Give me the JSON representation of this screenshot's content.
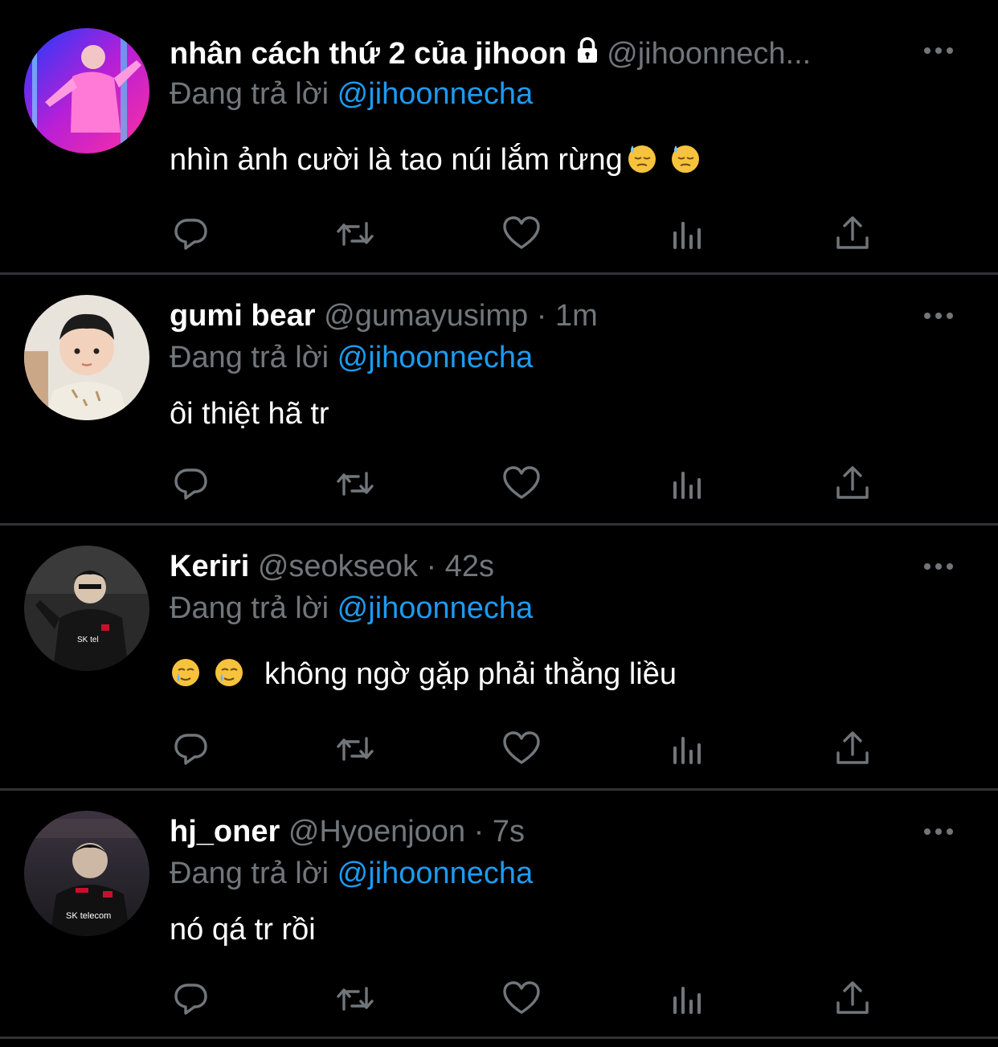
{
  "colors": {
    "background": "#000000",
    "primary_text": "#ffffff",
    "secondary_text": "#71767b",
    "link": "#1d9bf0",
    "divider": "#2f3336"
  },
  "tweets": [
    {
      "display_name": "nhân cách thứ 2 của jihoon",
      "verified_lock": "lock-icon",
      "handle": "@jihoonnech...",
      "dot": "",
      "time": "",
      "reply_prefix": "Đang trả lời ",
      "reply_to": "@jihoonnecha",
      "text": "nhìn ảnh cười là tao núi lắm rừng",
      "text_prefix": "",
      "emojis_after": [
        "downcast-sweat-emoji",
        "downcast-sweat-emoji"
      ],
      "emojis_before": [],
      "avatar": "avatar-neon-dancer"
    },
    {
      "display_name": "gumi bear",
      "handle": "@gumayusimp",
      "dot": "·",
      "time": "1m",
      "reply_prefix": "Đang trả lời ",
      "reply_to": "@jihoonnecha",
      "text": "ôi thiệt hã tr",
      "emojis_after": [],
      "emojis_before": [],
      "avatar": "avatar-child-photo"
    },
    {
      "display_name": "Keriri",
      "handle": "@seokseok",
      "dot": "·",
      "time": "42s",
      "reply_prefix": "Đang trả lời ",
      "reply_to": "@jihoonnecha",
      "text": "không ngờ gặp phải thằng liều",
      "emojis_after": [],
      "emojis_before": [
        "crying-smile-emoji",
        "crying-smile-emoji"
      ],
      "avatar": "avatar-dark-player"
    },
    {
      "display_name": "hj_oner",
      "handle": "@Hyoenjoon",
      "dot": "·",
      "time": "7s",
      "reply_prefix": "Đang trả lời ",
      "reply_to": "@jihoonnecha",
      "text": "nó qá tr rồi",
      "emojis_after": [],
      "emojis_before": [],
      "avatar": "avatar-player-sk-telecom"
    }
  ],
  "action_icons": [
    "reply-icon",
    "retweet-icon",
    "like-icon",
    "views-icon",
    "share-icon"
  ]
}
